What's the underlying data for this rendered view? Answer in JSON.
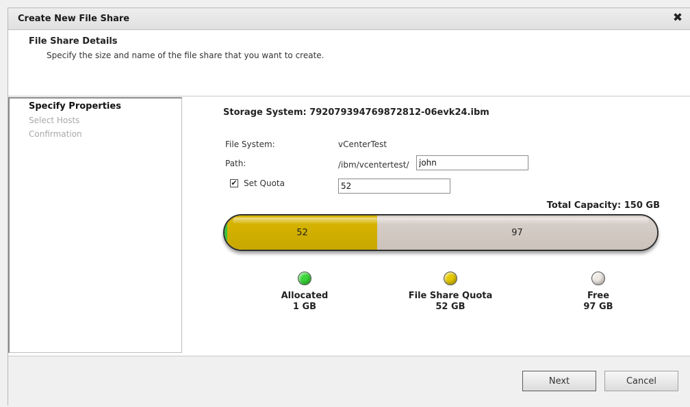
{
  "dialog": {
    "title": "Create New File Share",
    "close_symbol": "✖"
  },
  "header": {
    "title": "File Share Details",
    "description": "Specify the size and name of the file share that you want to create."
  },
  "steps": [
    {
      "label": "Specify Properties",
      "active": true
    },
    {
      "label": "Select Hosts",
      "active": false
    },
    {
      "label": "Confirmation",
      "active": false
    }
  ],
  "form": {
    "storage_system": "Storage System: 792079394769872812-06evk24.ibm",
    "file_system_label": "File System:",
    "file_system_value": "vCenterTest",
    "path_label": "Path:",
    "path_prefix": "/ibm/vcentertest/",
    "path_input": "john",
    "set_quota_label": "Set Quota",
    "set_quota_checked": true,
    "check_mark": "✔",
    "quota_input": "52"
  },
  "capacity": {
    "total_label": "Total Capacity: 150 GB",
    "total_gb": 150,
    "allocated_gb": 1,
    "quota_gb": 52,
    "free_gb": 97,
    "bar_quota_label": "52",
    "bar_free_label": "97"
  },
  "legend": [
    {
      "name": "Allocated",
      "value": "1 GB",
      "color": "#3ad63a"
    },
    {
      "name": "File Share Quota",
      "value": "52 GB",
      "color": "#e5c900"
    },
    {
      "name": "Free",
      "value": "97 GB",
      "color": "#efe9e4"
    }
  ],
  "footer": {
    "next_label": "Next",
    "cancel_label": "Cancel"
  }
}
